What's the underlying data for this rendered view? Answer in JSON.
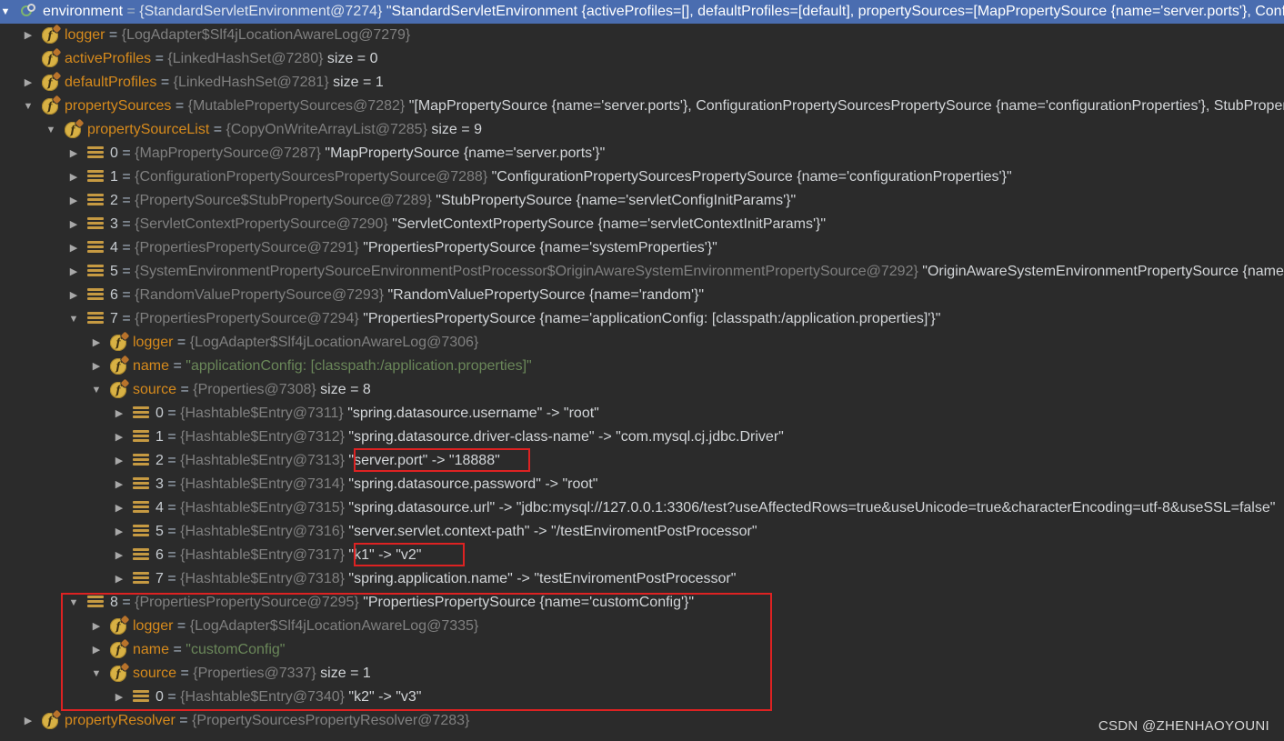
{
  "tree": [
    {
      "indent": 0,
      "arrow": "open",
      "icon": "env-icon",
      "kind": "sel",
      "name": "environment",
      "type": "{StandardServletEnvironment@7274}",
      "value": "\"StandardServletEnvironment {activeProfiles=[], defaultProfiles=[default], propertySources=[MapPropertySource {name='server.ports'}, Configurat"
    },
    {
      "indent": 1,
      "arrow": "closed",
      "icon": "field-icon",
      "kind": "f",
      "name": "logger",
      "type": "{LogAdapter$Slf4jLocationAwareLog@7279}",
      "value": ""
    },
    {
      "indent": 1,
      "arrow": "none",
      "icon": "field-icon",
      "kind": "f",
      "name": "activeProfiles",
      "type": "{LinkedHashSet@7280}",
      "value": " size = 0"
    },
    {
      "indent": 1,
      "arrow": "closed",
      "icon": "field-icon",
      "kind": "f",
      "name": "defaultProfiles",
      "type": "{LinkedHashSet@7281}",
      "value": " size = 1"
    },
    {
      "indent": 1,
      "arrow": "open",
      "icon": "field-icon",
      "kind": "f",
      "name": "propertySources",
      "type": "{MutablePropertySources@7282}",
      "value": "\"[MapPropertySource {name='server.ports'}, ConfigurationPropertySourcesPropertySource {name='configurationProperties'}, StubPropertySource {n"
    },
    {
      "indent": 2,
      "arrow": "open",
      "icon": "field-icon",
      "kind": "f",
      "name": "propertySourceList",
      "type": "{CopyOnWriteArrayList@7285}",
      "value": " size = 9"
    },
    {
      "indent": 3,
      "arrow": "closed",
      "icon": "entry-icon",
      "kind": "e",
      "name": "0",
      "type": "{MapPropertySource@7287}",
      "value": "\"MapPropertySource {name='server.ports'}\""
    },
    {
      "indent": 3,
      "arrow": "closed",
      "icon": "entry-icon",
      "kind": "e",
      "name": "1",
      "type": "{ConfigurationPropertySourcesPropertySource@7288}",
      "value": "\"ConfigurationPropertySourcesPropertySource {name='configurationProperties'}\""
    },
    {
      "indent": 3,
      "arrow": "closed",
      "icon": "entry-icon",
      "kind": "e",
      "name": "2",
      "type": "{PropertySource$StubPropertySource@7289}",
      "value": "\"StubPropertySource {name='servletConfigInitParams'}\""
    },
    {
      "indent": 3,
      "arrow": "closed",
      "icon": "entry-icon",
      "kind": "e",
      "name": "3",
      "type": "{ServletContextPropertySource@7290}",
      "value": "\"ServletContextPropertySource {name='servletContextInitParams'}\""
    },
    {
      "indent": 3,
      "arrow": "closed",
      "icon": "entry-icon",
      "kind": "e",
      "name": "4",
      "type": "{PropertiesPropertySource@7291}",
      "value": "\"PropertiesPropertySource {name='systemProperties'}\""
    },
    {
      "indent": 3,
      "arrow": "closed",
      "icon": "entry-icon",
      "kind": "e",
      "name": "5",
      "type": "{SystemEnvironmentPropertySourceEnvironmentPostProcessor$OriginAwareSystemEnvironmentPropertySource@7292}",
      "value": "\"OriginAwareSystemEnvironmentPropertySource {name='systemEnvironment'}\""
    },
    {
      "indent": 3,
      "arrow": "closed",
      "icon": "entry-icon",
      "kind": "e",
      "name": "6",
      "type": "{RandomValuePropertySource@7293}",
      "value": "\"RandomValuePropertySource {name='random'}\""
    },
    {
      "indent": 3,
      "arrow": "open",
      "icon": "entry-icon",
      "kind": "e",
      "name": "7",
      "type": "{PropertiesPropertySource@7294}",
      "value": "\"PropertiesPropertySource {name='applicationConfig: [classpath:/application.properties]'}\""
    },
    {
      "indent": 4,
      "arrow": "closed",
      "icon": "field-icon",
      "kind": "f",
      "name": "logger",
      "type": "{LogAdapter$Slf4jLocationAwareLog@7306}",
      "value": ""
    },
    {
      "indent": 4,
      "arrow": "closed",
      "icon": "field-icon",
      "kind": "f",
      "name": "name",
      "type": "",
      "value": "\"applicationConfig: [classpath:/application.properties]\"",
      "str": true
    },
    {
      "indent": 4,
      "arrow": "open",
      "icon": "field-icon",
      "kind": "f",
      "name": "source",
      "type": "{Properties@7308}",
      "value": " size = 8"
    },
    {
      "indent": 5,
      "arrow": "closed",
      "icon": "entry-icon",
      "kind": "e",
      "name": "0",
      "type": "{Hashtable$Entry@7311}",
      "value": "\"spring.datasource.username\" -> \"root\""
    },
    {
      "indent": 5,
      "arrow": "closed",
      "icon": "entry-icon",
      "kind": "e",
      "name": "1",
      "type": "{Hashtable$Entry@7312}",
      "value": "\"spring.datasource.driver-class-name\" -> \"com.mysql.cj.jdbc.Driver\""
    },
    {
      "indent": 5,
      "arrow": "closed",
      "icon": "entry-icon",
      "kind": "e",
      "name": "2",
      "type": "{Hashtable$Entry@7313}",
      "value": "\"server.port\" -> \"18888\""
    },
    {
      "indent": 5,
      "arrow": "closed",
      "icon": "entry-icon",
      "kind": "e",
      "name": "3",
      "type": "{Hashtable$Entry@7314}",
      "value": "\"spring.datasource.password\" -> \"root\""
    },
    {
      "indent": 5,
      "arrow": "closed",
      "icon": "entry-icon",
      "kind": "e",
      "name": "4",
      "type": "{Hashtable$Entry@7315}",
      "value": "\"spring.datasource.url\" -> \"jdbc:mysql://127.0.0.1:3306/test?useAffectedRows=true&useUnicode=true&characterEncoding=utf-8&useSSL=false\""
    },
    {
      "indent": 5,
      "arrow": "closed",
      "icon": "entry-icon",
      "kind": "e",
      "name": "5",
      "type": "{Hashtable$Entry@7316}",
      "value": "\"server.servlet.context-path\" -> \"/testEnviromentPostProcessor\""
    },
    {
      "indent": 5,
      "arrow": "closed",
      "icon": "entry-icon",
      "kind": "e",
      "name": "6",
      "type": "{Hashtable$Entry@7317}",
      "value": "\"k1\" -> \"v2\""
    },
    {
      "indent": 5,
      "arrow": "closed",
      "icon": "entry-icon",
      "kind": "e",
      "name": "7",
      "type": "{Hashtable$Entry@7318}",
      "value": "\"spring.application.name\" -> \"testEnviromentPostProcessor\""
    },
    {
      "indent": 3,
      "arrow": "open",
      "icon": "entry-icon",
      "kind": "e",
      "name": "8",
      "type": "{PropertiesPropertySource@7295}",
      "value": "\"PropertiesPropertySource {name='customConfig'}\""
    },
    {
      "indent": 4,
      "arrow": "closed",
      "icon": "field-icon",
      "kind": "f",
      "name": "logger",
      "type": "{LogAdapter$Slf4jLocationAwareLog@7335}",
      "value": ""
    },
    {
      "indent": 4,
      "arrow": "closed",
      "icon": "field-icon",
      "kind": "f",
      "name": "name",
      "type": "",
      "value": "\"customConfig\"",
      "str": true
    },
    {
      "indent": 4,
      "arrow": "open",
      "icon": "field-icon",
      "kind": "f",
      "name": "source",
      "type": "{Properties@7337}",
      "value": " size = 1"
    },
    {
      "indent": 5,
      "arrow": "closed",
      "icon": "entry-icon",
      "kind": "e",
      "name": "0",
      "type": "{Hashtable$Entry@7340}",
      "value": "\"k2\" -> \"v3\""
    },
    {
      "indent": 1,
      "arrow": "closed",
      "icon": "field-icon",
      "kind": "f",
      "name": "propertyResolver",
      "type": "{PropertySourcesPropertyResolver@7283}",
      "value": ""
    }
  ],
  "watermark": "CSDN @ZHENHAOYOUNI",
  "colors": {
    "background": "#2b2b2b",
    "selection": "#4a6db0",
    "field_name": "#d68a1c",
    "type_text": "#808080",
    "string_value": "#6a8759",
    "highlight_box": "#dd2222"
  }
}
